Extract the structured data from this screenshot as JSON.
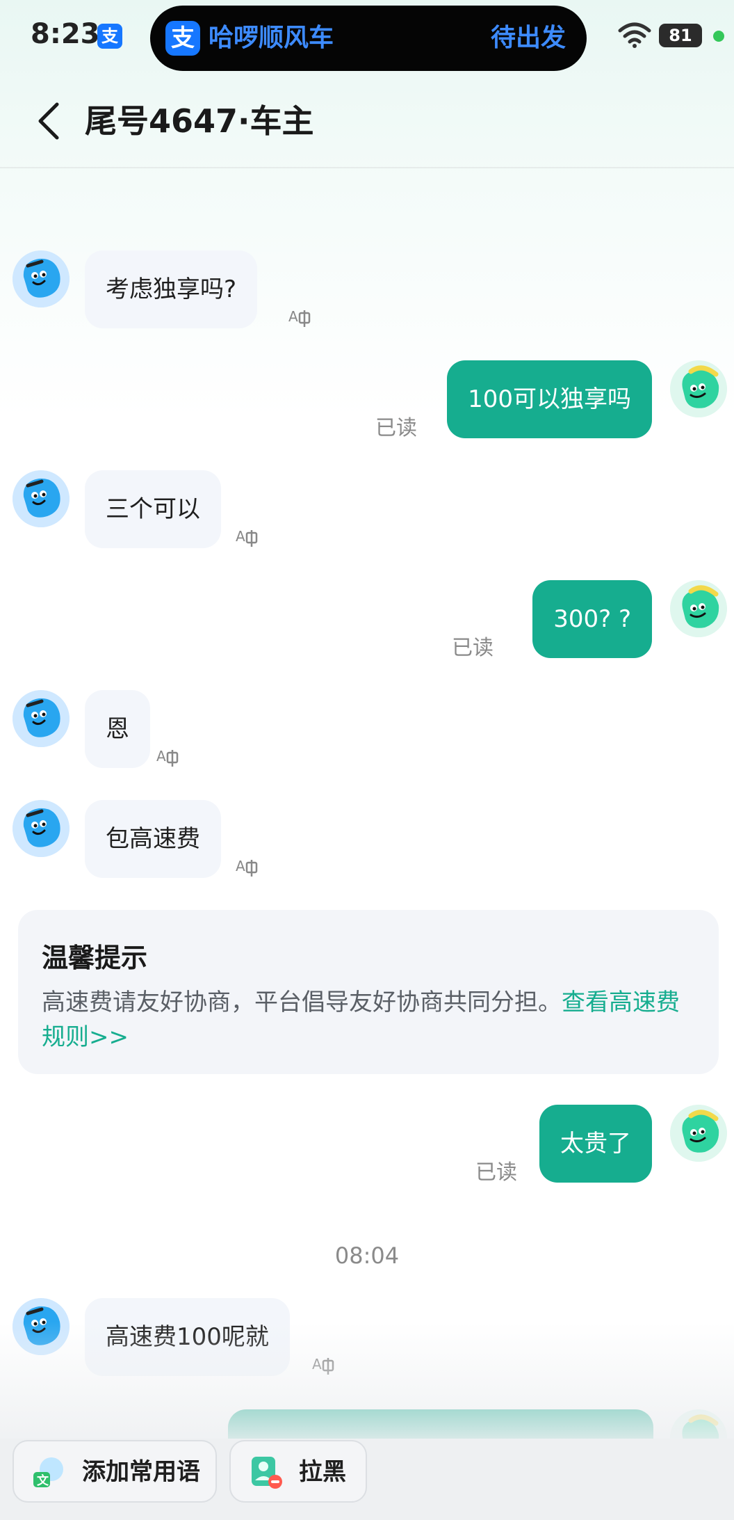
{
  "status_bar": {
    "time": "8:23",
    "alipay_mini_icon": "支",
    "island_logo": "支",
    "island_app": "哈啰顺风车",
    "island_status": "待出发",
    "battery": "81"
  },
  "nav": {
    "title": "尾号4647·车主"
  },
  "messages": [
    {
      "side": "in",
      "text": "考虑独享吗?"
    },
    {
      "side": "out",
      "text": "100可以独享吗",
      "status": "已读"
    },
    {
      "side": "in",
      "text": "三个可以"
    },
    {
      "side": "out",
      "text": "300? ?",
      "status": "已读"
    },
    {
      "side": "in",
      "text": "恩"
    },
    {
      "side": "in",
      "text": "包高速费"
    },
    {
      "side": "out",
      "text": "太贵了",
      "status": "已读"
    },
    {
      "side": "in",
      "text": "高速费100呢就"
    }
  ],
  "tip": {
    "title": "温馨提示",
    "body": "高速费请友好协商，平台倡导友好协商共同分担。",
    "link": "查看高速费规则>>"
  },
  "timestamp": "08:04",
  "bottom": {
    "add_phrase": "添加常用语",
    "block": "拉黑",
    "add_phrase_icon_text": "文"
  },
  "colors": {
    "accent": "#16ad8f",
    "incoming_bubble": "#f3f6fb",
    "island_text": "#3d8bff"
  },
  "icons": [
    "back-arrow-icon",
    "wifi-icon",
    "battery-icon",
    "translate-icon",
    "driver-avatar-icon",
    "passenger-avatar-icon",
    "add-phrase-icon",
    "block-user-icon"
  ]
}
